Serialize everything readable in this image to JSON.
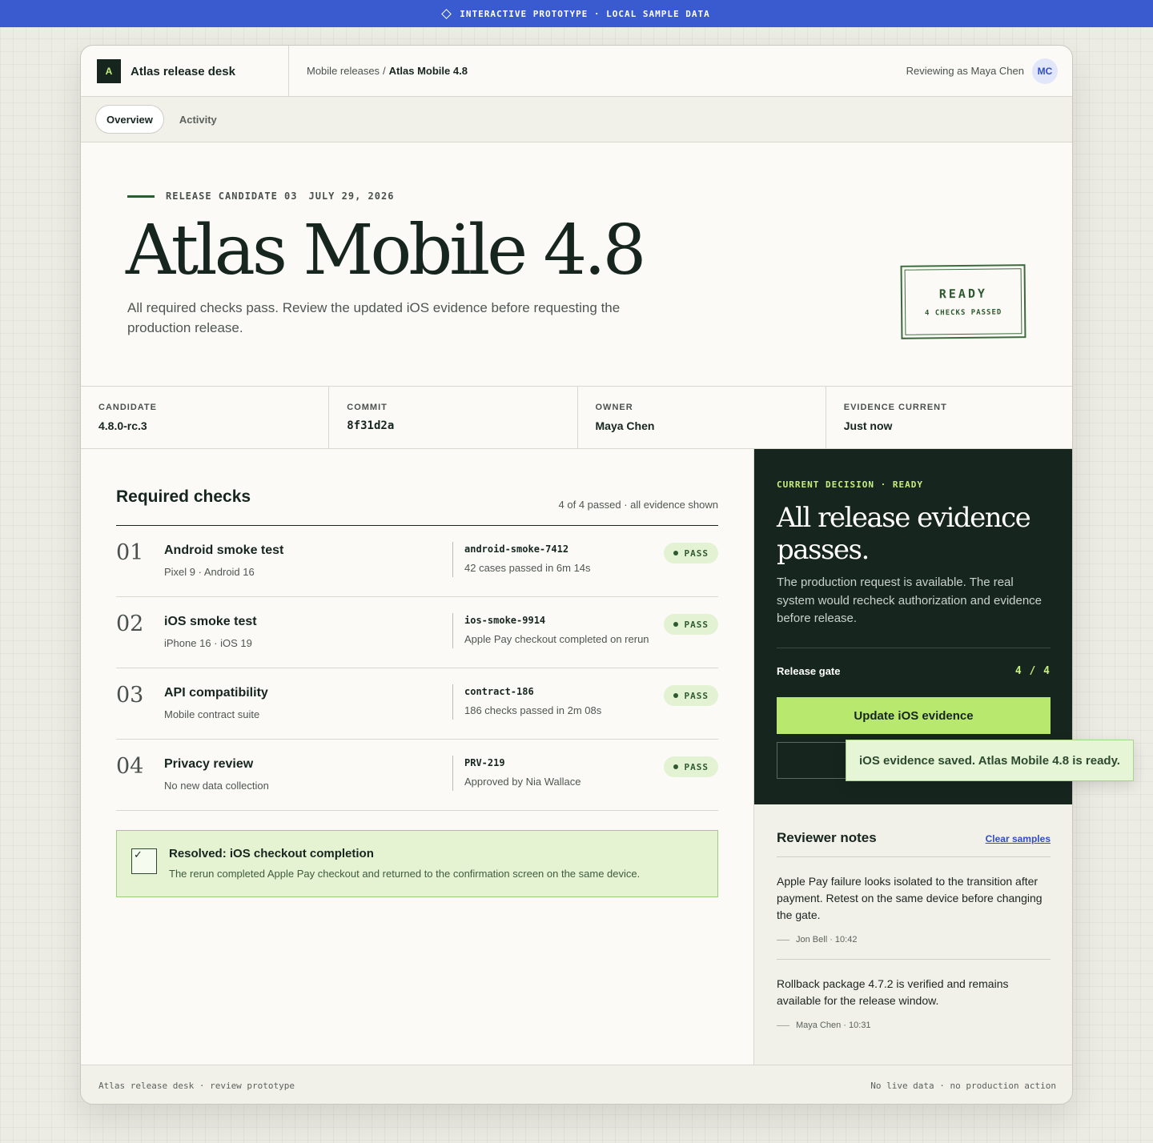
{
  "banner": {
    "text": "INTERACTIVE PROTOTYPE · LOCAL SAMPLE DATA"
  },
  "header": {
    "logo_letter": "A",
    "app_name": "Atlas release desk",
    "breadcrumb_parent": "Mobile releases",
    "breadcrumb_sep": "/",
    "breadcrumb_current": "Atlas Mobile 4.8",
    "reviewer_text": "Reviewing as Maya Chen",
    "avatar_initials": "MC"
  },
  "tabs": [
    {
      "label": "Overview",
      "active": true
    },
    {
      "label": "Activity",
      "active": false
    }
  ],
  "hero": {
    "eyebrow_candidate": "RELEASE CANDIDATE 03",
    "eyebrow_date": "JULY 29, 2026",
    "title": "Atlas Mobile 4.8",
    "lead": "All required checks pass. Review the updated iOS evidence before requesting the production release.",
    "stamp_status": "READY",
    "stamp_detail": "4 CHECKS PASSED"
  },
  "meta": [
    {
      "label": "CANDIDATE",
      "value": "4.8.0-rc.3"
    },
    {
      "label": "COMMIT",
      "value": "8f31d2a"
    },
    {
      "label": "OWNER",
      "value": "Maya Chen"
    },
    {
      "label": "EVIDENCE CURRENT",
      "value": "Just now"
    }
  ],
  "checks": {
    "heading": "Required checks",
    "summary": "4 of 4 passed · all evidence shown",
    "items": [
      {
        "num": "01",
        "title": "Android smoke test",
        "sub": "Pixel 9 · Android 16",
        "job": "android-smoke-7412",
        "detail": "42 cases passed in 6m 14s",
        "status": "PASS"
      },
      {
        "num": "02",
        "title": "iOS smoke test",
        "sub": "iPhone 16 · iOS 19",
        "job": "ios-smoke-9914",
        "detail": "Apple Pay checkout completed on rerun",
        "status": "PASS"
      },
      {
        "num": "03",
        "title": "API compatibility",
        "sub": "Mobile contract suite",
        "job": "contract-186",
        "detail": "186 checks passed in 2m 08s",
        "status": "PASS"
      },
      {
        "num": "04",
        "title": "Privacy review",
        "sub": "No new data collection",
        "job": "PRV-219",
        "detail": "Approved by Nia Wallace",
        "status": "PASS"
      }
    ],
    "resolved_title": "Resolved: iOS checkout completion",
    "resolved_text": "The rerun completed Apple Pay checkout and returned to the confirmation screen on the same device."
  },
  "decision": {
    "eyebrow": "CURRENT DECISION · READY",
    "title": "All release evidence passes.",
    "desc": "The production request is available. The real system would recheck authorization and evidence before release.",
    "gate_label": "Release gate",
    "gate_value": "4 / 4",
    "update_button": "Update iOS evidence"
  },
  "toast": {
    "text": "iOS evidence saved. Atlas Mobile 4.8 is ready."
  },
  "notes": {
    "heading": "Reviewer notes",
    "clear_link": "Clear samples",
    "items": [
      {
        "text": "Apple Pay failure looks isolated to the transition after payment. Retest on the same device before changing the gate.",
        "meta": "Jon Bell · 10:42"
      },
      {
        "text": "Rollback package 4.7.2 is verified and remains available for the release window.",
        "meta": "Maya Chen · 10:31"
      }
    ]
  },
  "footer": {
    "left": "Atlas release desk · review prototype",
    "right": "No live data · no production action"
  },
  "colors": {
    "banner": "#3a5bd0",
    "dark_panel": "#16261f",
    "accent_lime": "#b9e86f",
    "pass_green": "#2d5a2e",
    "link_blue": "#2f4fc6"
  }
}
